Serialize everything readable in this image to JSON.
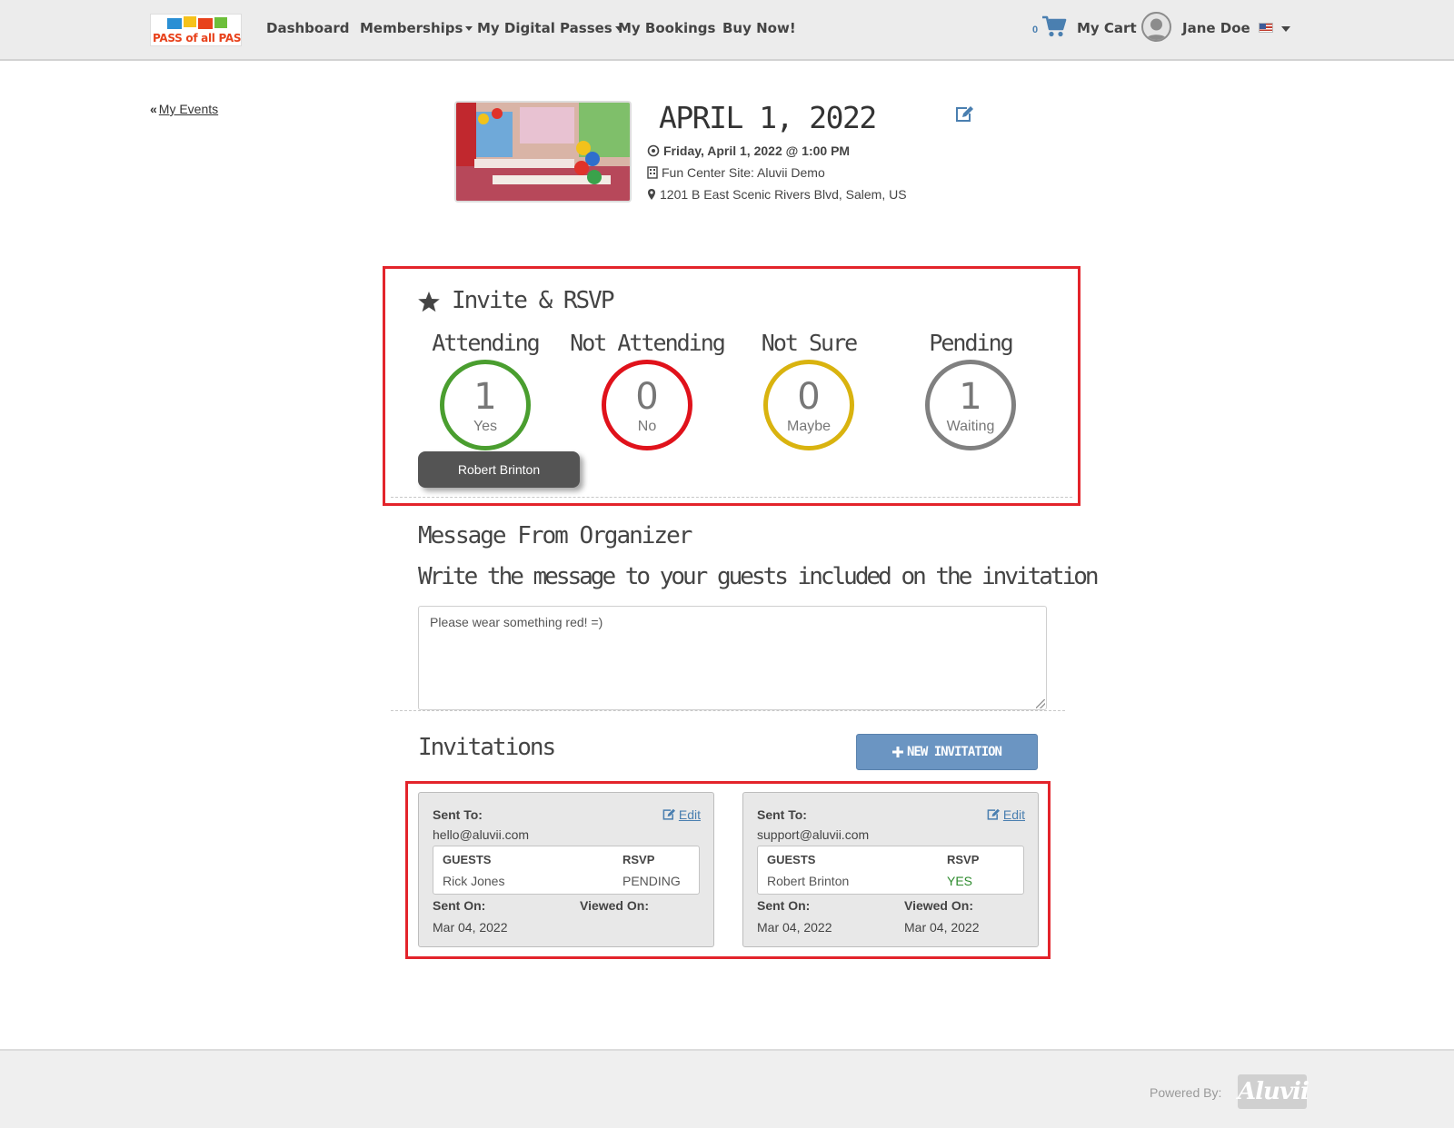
{
  "nav": {
    "logo_text": "PASS of all PASSES!",
    "items": [
      {
        "label": "Dashboard",
        "has_caret": false
      },
      {
        "label": "Memberships",
        "has_caret": true
      },
      {
        "label": "My Digital Passes",
        "has_caret": true
      },
      {
        "label": "My Bookings",
        "has_caret": false
      },
      {
        "label": "Buy Now!",
        "has_caret": false
      }
    ],
    "cart_count": "0",
    "cart_label": "My Cart",
    "user_name": "Jane Doe",
    "language_icon": "us-flag-icon"
  },
  "event": {
    "back_label": "My Events",
    "title": "APRIL 1, 2022",
    "datetime": "Friday, April 1, 2022 @ 1:00 PM",
    "site": "Fun Center Site: Aluvii Demo",
    "address": "1201 B East Scenic Rivers Blvd, Salem, US"
  },
  "rsvp": {
    "section_title": "Invite & RSVP",
    "stats": [
      {
        "label": "Attending",
        "count": "1",
        "sub": "Yes",
        "color": "#4a9e2f"
      },
      {
        "label": "Not Attending",
        "count": "0",
        "sub": "No",
        "color": "#e0121b"
      },
      {
        "label": "Not Sure",
        "count": "0",
        "sub": "Maybe",
        "color": "#d9b30f"
      },
      {
        "label": "Pending",
        "count": "1",
        "sub": "Waiting",
        "color": "#808080"
      }
    ],
    "attendee_chip": "Robert Brinton"
  },
  "message": {
    "section_title": "Message From Organizer",
    "prompt": "Write the message to your guests included on the invitation",
    "value": "Please wear something red! =)"
  },
  "invitations": {
    "section_title": "Invitations",
    "new_button": "NEW INVITATION",
    "labels": {
      "sent_to": "Sent To:",
      "edit": "Edit",
      "guests": "GUESTS",
      "rsvp": "RSVP",
      "sent_on": "Sent On:",
      "viewed_on": "Viewed On:"
    },
    "cards": [
      {
        "email": "hello@aluvii.com",
        "guest": "Rick Jones",
        "rsvp": "PENDING",
        "rsvp_color": "#555555",
        "sent_on": "Mar 04, 2022",
        "viewed_on": ""
      },
      {
        "email": "support@aluvii.com",
        "guest": "Robert Brinton",
        "rsvp": "YES",
        "rsvp_color": "#2e8b2e",
        "sent_on": "Mar 04, 2022",
        "viewed_on": "Mar 04, 2022"
      }
    ]
  },
  "footer": {
    "powered_by": "Powered By:",
    "brand": "Aluvii"
  }
}
